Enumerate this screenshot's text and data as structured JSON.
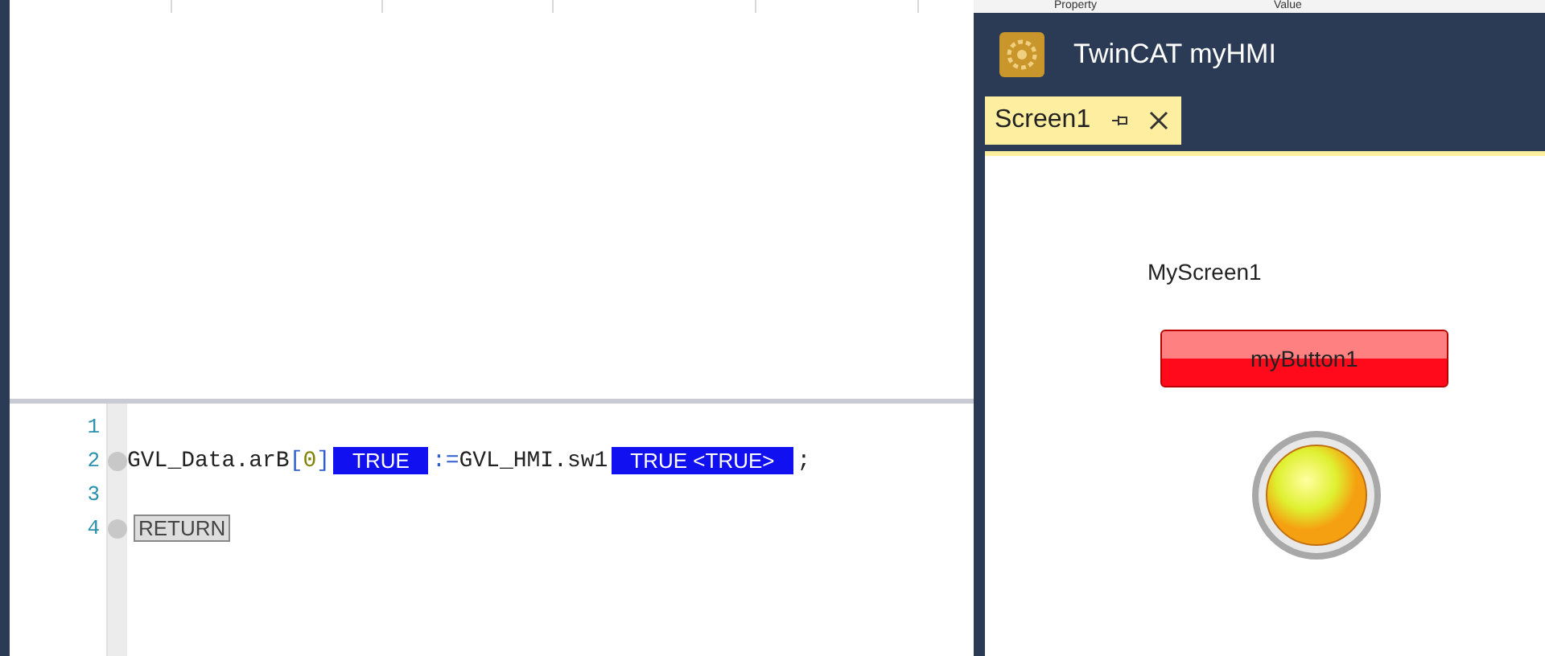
{
  "properties_header": {
    "columns": [
      "Property",
      "Value"
    ]
  },
  "editor": {
    "lines": [
      {
        "number": "1",
        "breakpoint": false
      },
      {
        "number": "2",
        "breakpoint": true,
        "parts": [
          {
            "kind": "code",
            "text": "GVL_Data.arB"
          },
          {
            "kind": "operator",
            "text": "["
          },
          {
            "kind": "number",
            "text": "0"
          },
          {
            "kind": "operator",
            "text": "]"
          },
          {
            "kind": "value",
            "text": "TRUE"
          },
          {
            "kind": "operator",
            "text": ":="
          },
          {
            "kind": "code",
            "text": "GVL_HMI.sw1"
          },
          {
            "kind": "value",
            "text": "TRUE <TRUE>"
          },
          {
            "kind": "code",
            "text": ";"
          }
        ]
      },
      {
        "number": "3",
        "breakpoint": false
      },
      {
        "number": "4",
        "breakpoint": true,
        "parts": [
          {
            "kind": "keyword",
            "text": "RETURN"
          }
        ]
      }
    ]
  },
  "hmi_window": {
    "title": "TwinCAT myHMI",
    "tabs": [
      {
        "label": "Screen1",
        "selected": true
      }
    ],
    "screen": {
      "label": "MyScreen1",
      "button": "myButton1",
      "lamp": {
        "on": true
      }
    }
  }
}
